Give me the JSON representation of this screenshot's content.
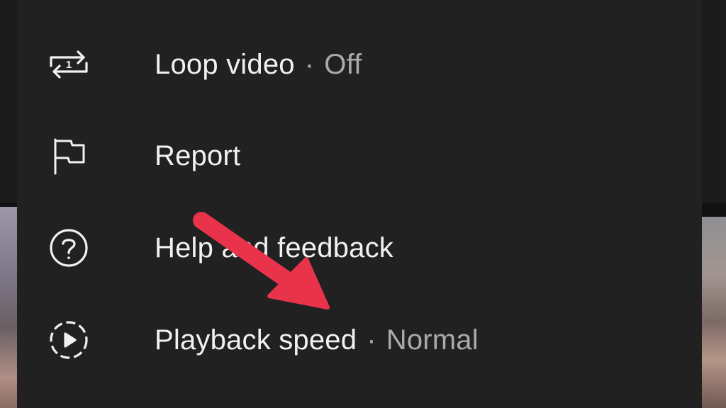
{
  "menu": {
    "items": [
      {
        "label": "Loop video",
        "value": "Off",
        "icon": "loop-one-icon"
      },
      {
        "label": "Report",
        "icon": "flag-icon"
      },
      {
        "label": "Help and feedback",
        "icon": "help-circle-icon"
      },
      {
        "label": "Playback speed",
        "value": "Normal",
        "icon": "playback-speed-icon"
      }
    ]
  },
  "colors": {
    "sheet_background": "#212121",
    "primary_text": "#f1f1f1",
    "secondary_text": "#aaaaaa",
    "annotation_arrow": "#e8334a"
  }
}
